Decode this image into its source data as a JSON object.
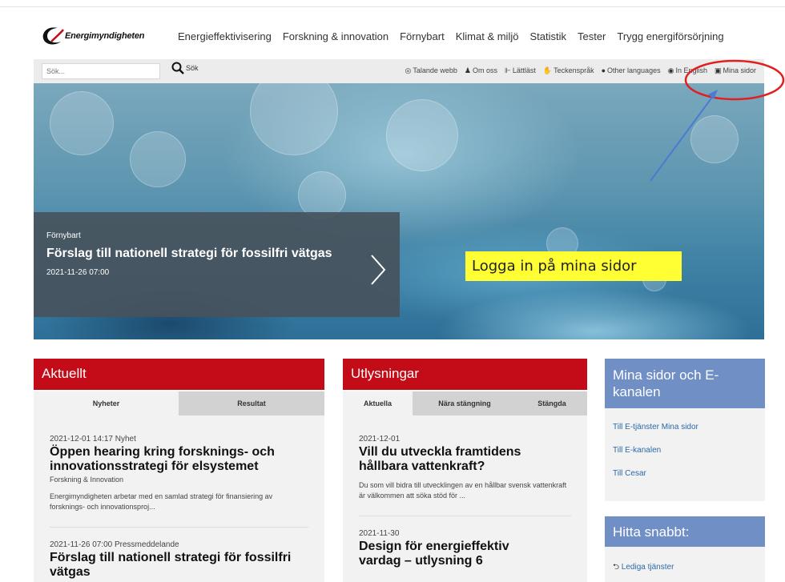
{
  "logo": {
    "text": "Energimyndigheten"
  },
  "main_nav": [
    "Energieffektivisering",
    "Forskning & innovation",
    "Förnybart",
    "Klimat & miljö",
    "Statistik",
    "Tester",
    "Trygg energiförsörjning"
  ],
  "search": {
    "placeholder": "Sök...",
    "button_label": "Sök"
  },
  "util_links": [
    {
      "icon": "speaker-icon",
      "glyph": "◎",
      "label": "Talande webb"
    },
    {
      "icon": "person-icon",
      "glyph": "♟",
      "label": "Om oss"
    },
    {
      "icon": "easy-read-icon",
      "glyph": "⊩",
      "label": "Lättläst"
    },
    {
      "icon": "sign-language-icon",
      "glyph": "✋",
      "label": "Teckenspråk"
    },
    {
      "icon": "speech-bubble-icon",
      "glyph": "●",
      "label": "Other languages"
    },
    {
      "icon": "globe-icon",
      "glyph": "◉",
      "label": "In English"
    },
    {
      "icon": "lock-icon",
      "glyph": "🔒",
      "label": "Mina sidor"
    }
  ],
  "hero": {
    "category": "Förnybart",
    "title": "Förslag till nationell strategi för fossilfri vätgas",
    "date": "2021-11-26 07:00"
  },
  "callout": {
    "text": "Logga in på mina sidor",
    "color": "#ffff33",
    "marker_color": "#e02020",
    "arrow_color": "#4a7bd0"
  },
  "aktuellt": {
    "heading": "Aktuellt",
    "tabs": [
      "Nyheter",
      "Resultat"
    ],
    "items": [
      {
        "meta": "2021-12-01 14:17 Nyhet",
        "title": "Öppen hearing kring forsknings- och innovationsstrategi för elsystemet",
        "sub": "Forskning & Innovation",
        "text": "Energimyndigheten arbetar med en samlad strategi för finansiering av forsknings- och innovationsproj..."
      },
      {
        "meta": "2021-11-26 07:00 Pressmeddelande",
        "title": "Förslag till nationell strategi för fossilfri vätgas"
      }
    ]
  },
  "utlysningar": {
    "heading": "Utlysningar",
    "tabs": [
      "Aktuella",
      "Nära stängning",
      "Stängda"
    ],
    "items": [
      {
        "meta": "2021-12-01",
        "title": "Vill du utveckla framtidens hållbara vattenkraft?",
        "text": "Du som vill bidra till utvecklingen av en hållbar svensk vattenkraft är välkommen att söka stöd för ..."
      },
      {
        "meta": "2021-11-30",
        "title": "Design för energieffektiv vardag – utlysning 6"
      }
    ]
  },
  "mina_sidor": {
    "heading": "Mina sidor och E-kanalen",
    "links": [
      "Till E-tjänster Mina sidor",
      "Till E-kanalen",
      "Till Cesar"
    ]
  },
  "hitta_snabbt": {
    "heading": "Hitta snabbt:",
    "links": [
      {
        "icon": "reply-icon",
        "glyph": "⮌",
        "label": "Lediga tjänster"
      }
    ]
  },
  "colors": {
    "red": "#c30c17",
    "blue_panel": "#6f8fc5",
    "link": "#2b6aa8"
  }
}
